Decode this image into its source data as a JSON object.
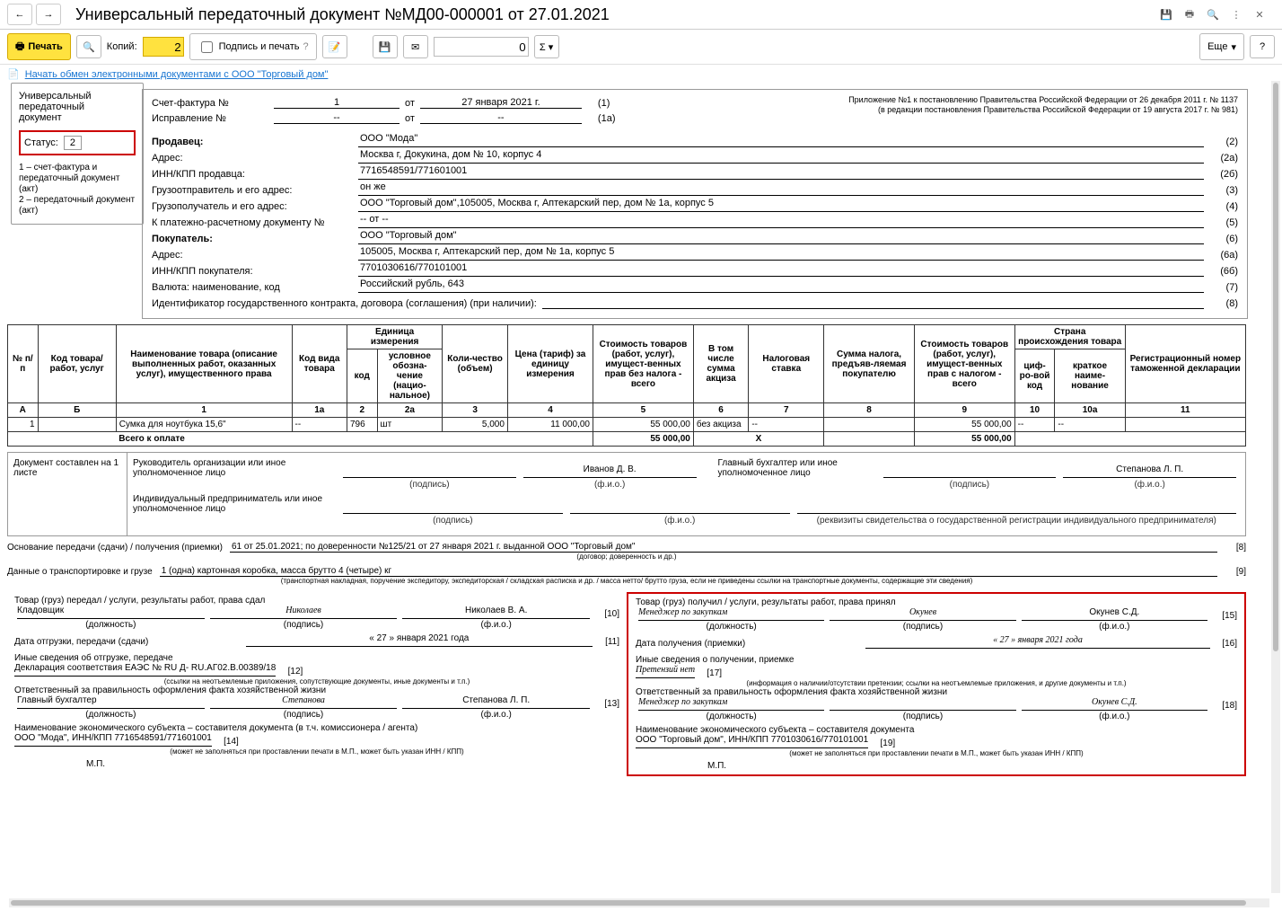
{
  "title": "Универсальный передаточный документ №МД00-000001 от 27.01.2021",
  "toolbar": {
    "print": "Печать",
    "copies_label": "Копий:",
    "copies_value": "2",
    "sign_print": "Подпись и печать",
    "num_field": "0",
    "more": "Еще"
  },
  "edo_link": "Начать обмен электронными документами с ООО \"Торговый дом\"",
  "leftbox": {
    "title1": "Универсальный",
    "title2": "передаточный",
    "title3": "документ",
    "status_label": "Статус:",
    "status_value": "2",
    "note": "1 – счет-фактура и передаточный документ (акт)\n2 – передаточный документ (акт)"
  },
  "reg_note1": "Приложение №1 к постановлению Правительства Российской Федерации от 26 декабря 2011 г. № 1137",
  "reg_note2": "(в редакции постановления Правительства Российской Федерации от 19 августа 2017 г. № 981)",
  "sf_no_label": "Счет-фактура №",
  "sf_no": "1",
  "sf_ot": "от",
  "sf_date": "27 января 2021 г.",
  "sf_num": "(1)",
  "ispr_label": "Исправление №",
  "ispr_no": "--",
  "ispr_date": "--",
  "ispr_num": "(1а)",
  "rows": {
    "seller_label": "Продавец:",
    "seller": "ООО \"Мода\"",
    "addr_label": "Адрес:",
    "seller_addr": "Москва г, Докукина, дом № 10, корпус 4",
    "inn_seller_label": "ИНН/КПП продавца:",
    "inn_seller": "7716548591/771601001",
    "shipper_label": "Грузоотправитель и его адрес:",
    "shipper": "он же",
    "consignee_label": "Грузополучатель и его адрес:",
    "consignee": "ООО \"Торговый дом\",105005, Москва г, Аптекарский пер, дом № 1а, корпус 5",
    "payment_label": "К платежно-расчетному документу №",
    "payment": "-- от --",
    "buyer_label": "Покупатель:",
    "buyer": "ООО \"Торговый дом\"",
    "buyer_addr": "105005, Москва г, Аптекарский пер, дом № 1а, корпус 5",
    "inn_buyer_label": "ИНН/КПП покупателя:",
    "inn_buyer": "7701030616/770101001",
    "currency_label": "Валюта: наименование, код",
    "currency": "Российский рубль, 643",
    "contract_label": "Идентификатор государственного контракта, договора (соглашения) (при наличии):"
  },
  "nums": {
    "n2": "(2)",
    "n2a": "(2а)",
    "n2b": "(2б)",
    "n3": "(3)",
    "n4": "(4)",
    "n5": "(5)",
    "n6": "(6)",
    "n6a": "(6а)",
    "n6b": "(6б)",
    "n7": "(7)",
    "n8": "(8)"
  },
  "th": {
    "c1": "№ п/п",
    "c2": "Код товара/ работ, услуг",
    "c3": "Наименование товара (описание выполненных работ, оказанных услуг), имущественного права",
    "c4": "Код вида товара",
    "c5": "Единица измерения",
    "c5a": "код",
    "c5b": "условное обозна-чение (нацио-нальное)",
    "c6": "Коли-чество (объем)",
    "c7": "Цена (тариф) за единицу измерения",
    "c8": "Стоимость товаров (работ, услуг), имущест-венных прав без налога - всего",
    "c9": "В том числе сумма акциза",
    "c10": "Налоговая ставка",
    "c11": "Сумма налога, предъяв-ляемая покупателю",
    "c12": "Стоимость товаров (работ, услуг), имущест-венных прав с налогом - всего",
    "c13": "Страна происхождения товара",
    "c13a": "циф-ро-вой код",
    "c13b": "краткое наиме-нование",
    "c14": "Регистрационный номер таможенной декларации"
  },
  "colnums": {
    "a": "А",
    "b": "Б",
    "c1": "1",
    "c1a": "1а",
    "c2": "2",
    "c2a": "2а",
    "c3": "3",
    "c4": "4",
    "c5": "5",
    "c6": "6",
    "c7": "7",
    "c8": "8",
    "c9": "9",
    "c10": "10",
    "c10a": "10а",
    "c11": "11"
  },
  "row1": {
    "n": "1",
    "code": "",
    "name": "Сумка для ноутбука 15,6\"",
    "kind": "--",
    "ucode": "796",
    "uname": "шт",
    "qty": "5,000",
    "price": "11 000,00",
    "sum": "55 000,00",
    "akc": "без акциза",
    "rate": "--",
    "tax": "",
    "total": "55 000,00",
    "ccode": "--",
    "cname": "--",
    "decl": ""
  },
  "totals": {
    "label": "Всего к оплате",
    "sum": "55 000,00",
    "x": "X",
    "total": "55 000,00"
  },
  "sig": {
    "doc_made": "Документ составлен на 1 листе",
    "ruk_label": "Руководитель организации или иное уполномоченное лицо",
    "ruk_fio": "Иванов Д. В.",
    "glav_label": "Главный бухгалтер или иное уполномоченное лицо",
    "glav_fio": "Степанова Л. П.",
    "ip_label": "Индивидуальный предприниматель или иное уполномоченное лицо",
    "podpis": "(подпись)",
    "fio": "(ф.и.о.)",
    "rekv": "(реквизиты свидетельства о государственной  регистрации индивидуального предпринимателя)"
  },
  "bottom": {
    "osn_label": "Основание передачи (сдачи) / получения (приемки)",
    "osn": "61 от 25.01.2021; по доверенности №125/21 от 27 января 2021 г. выданной ООО \"Торговый дом\"",
    "osn_cap": "(договор; доверенность и др.)",
    "trans_label": "Данные о транспортировке и грузе",
    "trans": "1 (одна) картонная коробка, масса брутто 4 (четыре) кг",
    "trans_cap": "(транспортная накладная, поручение экспедитору, экспедиторская / складская расписка и др. / масса нетто/ брутто груза, если не приведены ссылки на транспортные документы, содержащие эти сведения)",
    "n8": "[8]",
    "n9": "[9]"
  },
  "left": {
    "h1": "Товар (груз) передал / услуги, результаты работ, права сдал",
    "post": "Кладовщик",
    "sign": "Николаев",
    "fio": "Николаев В. А.",
    "date_label": "Дата отгрузки, передачи (сдачи)",
    "date": "« 27 »   января   2021   года",
    "other_label": "Иные сведения об отгрузке, передаче",
    "other": "Декларация соответствия ЕАЭС № RU Д- RU.АГ02.В.00389/18",
    "other_cap": "(ссылки на неотъемлемые приложения, сопутствующие документы, иные документы и т.п.)",
    "resp_label": "Ответственный за правильность оформления факта хозяйственной жизни",
    "resp_post": "Главный бухгалтер",
    "resp_sign": "Степанова",
    "resp_fio": "Степанова Л. П.",
    "subj_label": "Наименование экономического субъекта – составителя документа (в т.ч. комиссионера / агента)",
    "subj": "ООО \"Мода\", ИНН/КПП 7716548591/771601001",
    "subj_cap": "(может не заполняться при проставлении печати в М.П., может быть указан ИНН / КПП)",
    "mp": "М.П.",
    "n10": "[10]",
    "n11": "[11]",
    "n12": "[12]",
    "n13": "[13]",
    "n14": "[14]"
  },
  "right": {
    "h1": "Товар (груз) получил / услуги, результаты работ, права принял",
    "post": "Менеджер по закупкам",
    "sign": "Окунев",
    "fio": "Окунев С.Д.",
    "date_label": "Дата получения (приемки)",
    "date": "« 27 »   января   2021   года",
    "other_label": "Иные сведения о получении, приемке",
    "other": "Претензий нет",
    "other_cap": "(информация о наличии/отсутствии претензии; ссылки на неотъемлемые приложения, и другие  документы и т.п.)",
    "resp_label": "Ответственный за правильность оформления факта хозяйственной жизни",
    "resp_post": "Менеджер по закупкам",
    "resp_sign": "",
    "resp_fio": "Окунев С.Д.",
    "subj_label": "Наименование экономического субъекта – составителя документа",
    "subj": "ООО \"Торговый дом\", ИНН/КПП 7701030616/770101001",
    "subj_cap": "(может не заполняться при проставлении печати в М.П., может быть указан ИНН / КПП)",
    "mp": "М.П.",
    "n15": "[15]",
    "n16": "[16]",
    "n17": "[17]",
    "n18": "[18]",
    "n19": "[19]"
  },
  "caps": {
    "post": "(должность)",
    "podpis": "(подпись)",
    "fio": "(ф.и.о.)"
  }
}
